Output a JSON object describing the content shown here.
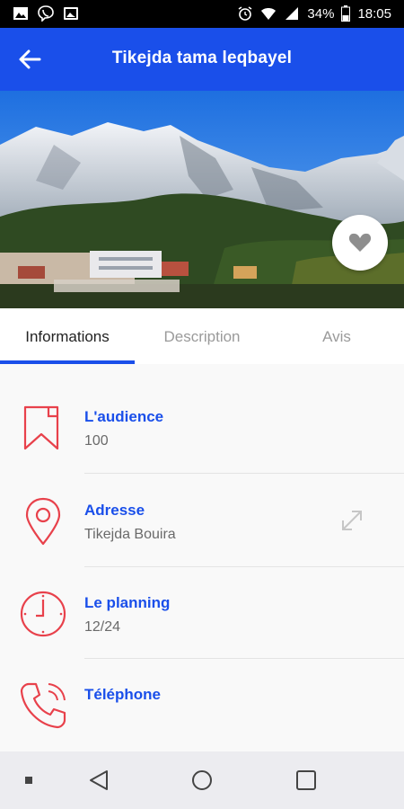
{
  "status_bar": {
    "battery": "34%",
    "time": "18:05",
    "left_icons": [
      "gallery-icon",
      "viber-icon",
      "image-icon"
    ],
    "right_icons": [
      "alarm-icon",
      "wifi-icon",
      "signal-icon",
      "battery-icon"
    ]
  },
  "app_bar": {
    "title": "Tikejda tama leqbayel",
    "back_icon": "arrow-left-icon"
  },
  "hero": {
    "favorite_icon": "heart-icon"
  },
  "tabs": [
    {
      "label": "Informations",
      "active": true
    },
    {
      "label": "Description",
      "active": false
    },
    {
      "label": "Avis",
      "active": false
    }
  ],
  "info": [
    {
      "label": "L'audience",
      "value": "100",
      "icon": "bookmark-icon"
    },
    {
      "label": "Adresse",
      "value": "Tikejda Bouira",
      "icon": "location-pin-icon"
    },
    {
      "label": "Le planning",
      "value": "12/24",
      "icon": "clock-icon"
    },
    {
      "label": "Téléphone",
      "value": "",
      "icon": "phone-icon"
    }
  ],
  "colors": {
    "accent": "#1a4fea",
    "icon_red": "#e8414b",
    "label_blue": "#1a4fea"
  },
  "nav_bar": {
    "icons": [
      "square-dot-icon",
      "back-triangle-icon",
      "home-circle-icon",
      "recents-square-icon"
    ]
  }
}
